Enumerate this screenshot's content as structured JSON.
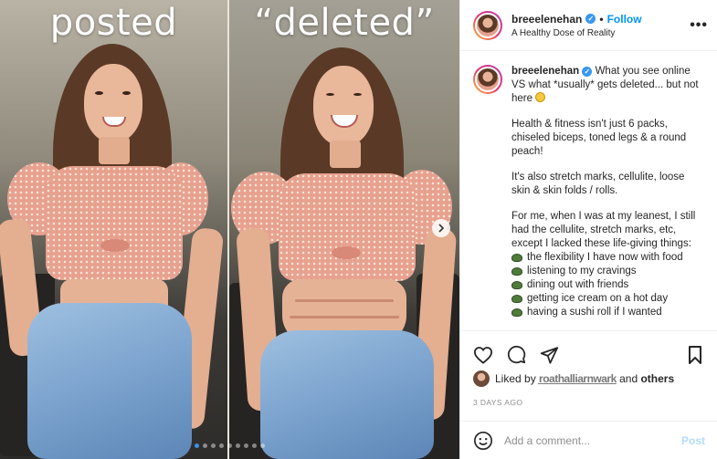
{
  "media": {
    "left_caption": "posted",
    "right_caption": "“deleted”",
    "carousel_dots": 9,
    "active_dot": 0
  },
  "header": {
    "username": "breeelenehan",
    "separator": "•",
    "follow_label": "Follow",
    "subtitle": "A Healthy Dose of Reality",
    "more_label": "•••"
  },
  "caption": {
    "username": "breeelenehan",
    "intro": "What you see online VS what *usually* gets deleted... but not here",
    "paragraphs": [
      "Health & fitness isn't just 6 packs, chiseled biceps, toned legs & a round peach!",
      "It's also stretch marks, cellulite, loose skin & skin folds / rolls.",
      "For me, when I was at my leanest, I still had the cellulite, stretch marks, etc, except I lacked these life-giving things:"
    ],
    "list": [
      "the flexibility I have now with food",
      "listening to my cravings",
      "dining out with friends",
      "getting ice cream on a hot day",
      "having a sushi roll if I wanted"
    ]
  },
  "actions": {
    "like": "heart-icon",
    "comment": "comment-icon",
    "share": "share-icon",
    "save": "bookmark-icon"
  },
  "likes": {
    "prefix": "Liked by",
    "blurred_name": "r͟o͟a͟t͟h͟a͟l͟l͟i͟a͟r͟n͟w͟a͟r͟k",
    "connector": "and",
    "others": "others"
  },
  "date": "3 DAYS AGO",
  "comment_box": {
    "placeholder": "Add a comment...",
    "post_label": "Post"
  },
  "colors": {
    "accent_blue": "#0095f6",
    "post_disabled": "#b3dbff",
    "muted_text": "#8e8e8e",
    "border": "#efefef"
  }
}
